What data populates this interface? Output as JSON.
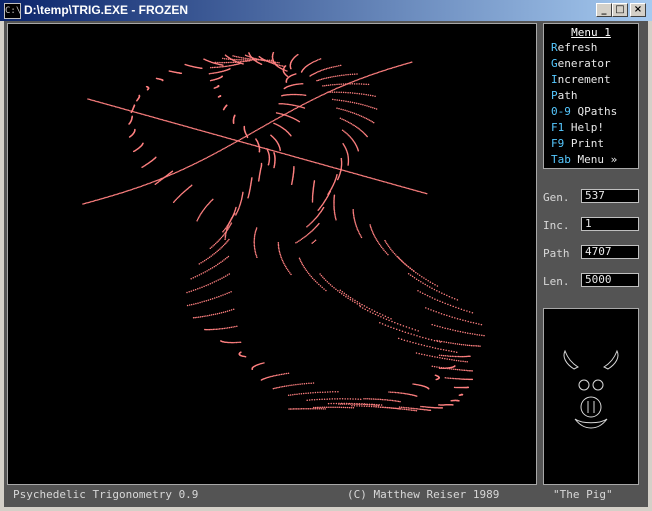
{
  "window": {
    "title": "D:\\temp\\TRIG.EXE - FROZEN",
    "icon_text": "C:\\",
    "controls": {
      "minimize": "_",
      "maximize": "□",
      "close": "×"
    }
  },
  "menu": {
    "title": "Menu 1",
    "items": [
      {
        "key": "R",
        "rest": "efresh"
      },
      {
        "key": "G",
        "rest": "enerator"
      },
      {
        "key": "I",
        "rest": "ncrement"
      },
      {
        "key": "P",
        "rest": "ath"
      },
      {
        "key": "0-9",
        "rest": " QPaths"
      },
      {
        "key": "F1",
        "rest": " Help!"
      },
      {
        "key": "F9",
        "rest": " Print"
      },
      {
        "key": "Tab",
        "rest": " Menu »"
      }
    ]
  },
  "fields": [
    {
      "label": "Gen.",
      "value": "537"
    },
    {
      "label": "Inc.",
      "value": "1"
    },
    {
      "label": "Path",
      "value": "4707"
    },
    {
      "label": "Len.",
      "value": "5000"
    }
  ],
  "status": {
    "left": "Psychedelic Trigonometry 0.9",
    "center": "(C) Matthew Reiser 1989",
    "right": "\"The Pig\""
  },
  "colors": {
    "curve": "#ff8080",
    "canvas": "#000000",
    "menu_key": "#56c8ff"
  }
}
